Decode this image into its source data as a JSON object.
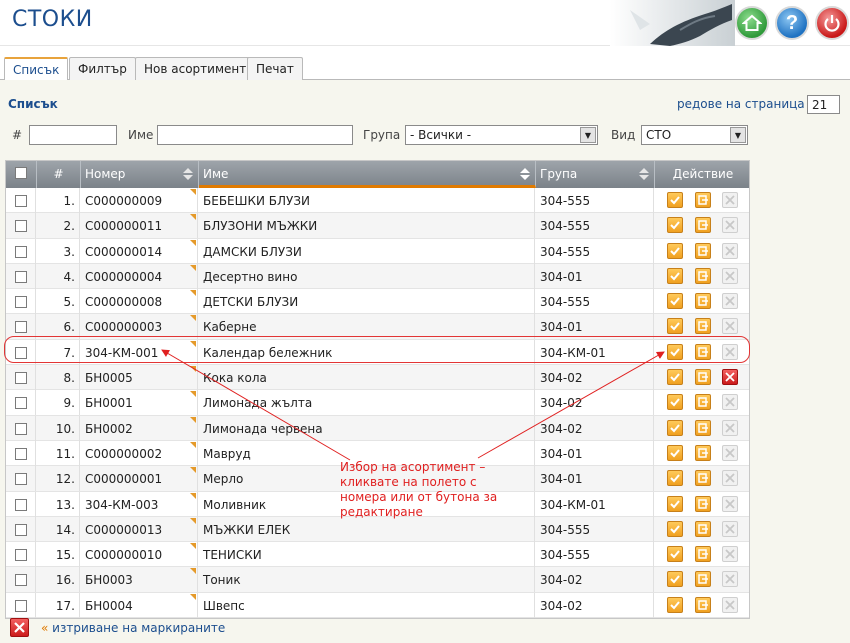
{
  "header": {
    "title": "СТОКИ",
    "icons": [
      "home-icon",
      "help-icon",
      "power-icon"
    ],
    "help_glyph": "?"
  },
  "tabs": [
    {
      "label": "Списък",
      "active": true
    },
    {
      "label": "Филтър",
      "active": false
    },
    {
      "label": "Нов асортимент",
      "active": false
    },
    {
      "label": "Печат",
      "active": false
    }
  ],
  "list": {
    "section_title": "Списък",
    "rows_per_page_label": "редове на страница",
    "rows_per_page_arrow": "»",
    "rows_per_page_value": "21"
  },
  "filters": {
    "num_label": "#",
    "name_label": "Име",
    "group_label": "Група",
    "group_value": "- Всички -",
    "type_label": "Вид",
    "type_value": "СТО"
  },
  "table": {
    "columns": {
      "num": "#",
      "code": "Номер",
      "name": "Име",
      "group": "Група",
      "action": "Действие"
    },
    "rows": [
      {
        "n": "1.",
        "code": "С000000009",
        "name": "БЕБЕШКИ БЛУЗИ",
        "group": "304-555",
        "delete_enabled": false
      },
      {
        "n": "2.",
        "code": "С000000011",
        "name": "БЛУЗОНИ МЪЖКИ",
        "group": "304-555",
        "delete_enabled": false
      },
      {
        "n": "3.",
        "code": "С000000014",
        "name": "ДАМСКИ БЛУЗИ",
        "group": "304-555",
        "delete_enabled": false
      },
      {
        "n": "4.",
        "code": "С000000004",
        "name": "Десертно вино",
        "group": "304-01",
        "delete_enabled": false
      },
      {
        "n": "5.",
        "code": "С000000008",
        "name": "ДЕТСКИ БЛУЗИ",
        "group": "304-555",
        "delete_enabled": false
      },
      {
        "n": "6.",
        "code": "С000000003",
        "name": "Каберне",
        "group": "304-01",
        "delete_enabled": false
      },
      {
        "n": "7.",
        "code": "304-КМ-001",
        "name": "Календар бележник",
        "group": "304-КМ-01",
        "delete_enabled": false
      },
      {
        "n": "8.",
        "code": "БН0005",
        "name": "Кока кола",
        "group": "304-02",
        "delete_enabled": true
      },
      {
        "n": "9.",
        "code": "БН0001",
        "name": "Лимонада жълта",
        "group": "304-02",
        "delete_enabled": false
      },
      {
        "n": "10.",
        "code": "БН0002",
        "name": "Лимонада червена",
        "group": "304-02",
        "delete_enabled": false
      },
      {
        "n": "11.",
        "code": "С000000002",
        "name": "Мавруд",
        "group": "304-01",
        "delete_enabled": false
      },
      {
        "n": "12.",
        "code": "С000000001",
        "name": "Мерло",
        "group": "304-01",
        "delete_enabled": false
      },
      {
        "n": "13.",
        "code": "304-КМ-003",
        "name": "Моливник",
        "group": "304-КМ-01",
        "delete_enabled": false
      },
      {
        "n": "14.",
        "code": "С000000013",
        "name": "МЪЖКИ ЕЛЕК",
        "group": "304-555",
        "delete_enabled": false
      },
      {
        "n": "15.",
        "code": "С000000010",
        "name": "ТЕНИСКИ",
        "group": "304-555",
        "delete_enabled": false
      },
      {
        "n": "16.",
        "code": "БН0003",
        "name": "Тоник",
        "group": "304-02",
        "delete_enabled": false
      },
      {
        "n": "17.",
        "code": "БН0004",
        "name": "Швепс",
        "group": "304-02",
        "delete_enabled": false
      }
    ]
  },
  "footer": {
    "arrow": "«",
    "delete_marked_label": "изтриване на маркираните"
  },
  "annotation": {
    "text": "Избор на асортимент – кликвате на полето с номера или от бутона за редактиране",
    "color": "#e02020"
  }
}
